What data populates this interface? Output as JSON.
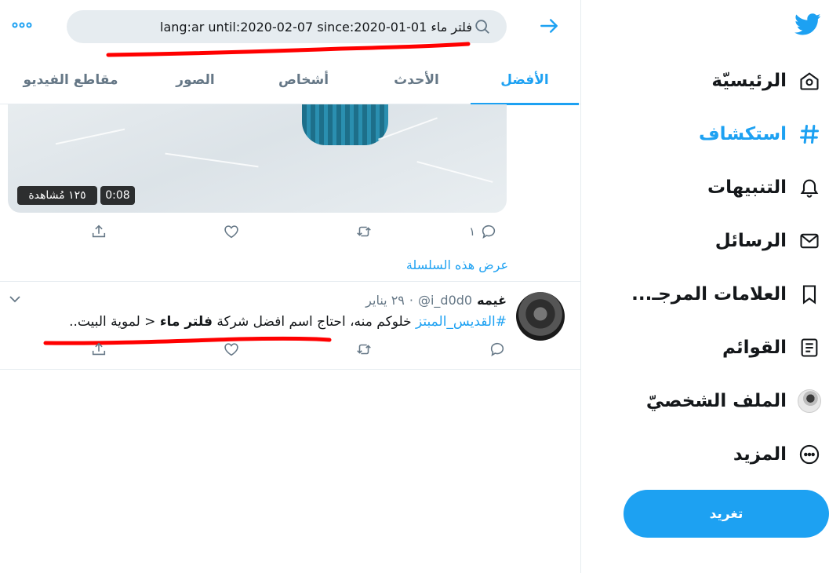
{
  "nav": {
    "items": [
      {
        "label": "الرئيسيّة",
        "icon": "home-icon"
      },
      {
        "label": "استكشاف",
        "icon": "hashtag-icon",
        "active": true
      },
      {
        "label": "التنبيهات",
        "icon": "bell-icon"
      },
      {
        "label": "الرسائل",
        "icon": "envelope-icon"
      },
      {
        "label": "العلامات المرجـ...",
        "icon": "bookmark-icon"
      },
      {
        "label": "القوائم",
        "icon": "list-icon"
      },
      {
        "label": "الملف الشخصيّ",
        "icon": "avatar"
      },
      {
        "label": "المزيد",
        "icon": "more-circle-icon"
      }
    ],
    "tweet_button": "تغريد"
  },
  "search": {
    "query": "lang:ar until:2020-02-07 since:2020-01-01 فلتر ماء"
  },
  "tabs": [
    {
      "label": "الأفضل",
      "active": true
    },
    {
      "label": "الأحدث"
    },
    {
      "label": "أشخاص"
    },
    {
      "label": "الصور"
    },
    {
      "label": "مقاطع الفيديو"
    }
  ],
  "video": {
    "duration": "0:08",
    "views": "١٢٥ مُشاهدة"
  },
  "tweet1": {
    "reply_count": "١",
    "thread_link": "عرض هذه السلسلة"
  },
  "tweet2": {
    "name": "غيمه",
    "handle": "@i_d0d0",
    "date": "٢٩ يناير",
    "separator": "·",
    "hashtag": "#القديس_المبتز",
    "text_1": " خلوكم منه، احتاج اسم افضل شركة ",
    "text_bold": "فلتر ماء",
    "text_2": " < لموية البيت.."
  },
  "colors": {
    "accent": "#1da1f2",
    "text": "#14171a",
    "muted": "#657786",
    "search_bg": "#e6ecf0",
    "annotation": "#ff0000"
  }
}
